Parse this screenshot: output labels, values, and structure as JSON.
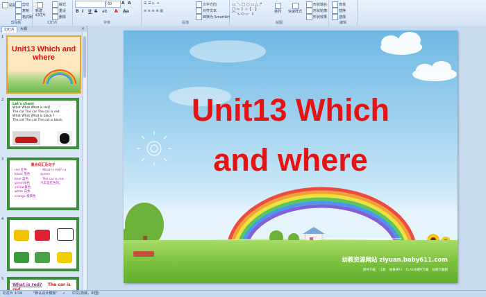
{
  "ribbon": {
    "groups": [
      {
        "label": "剪贴板"
      },
      {
        "label": "幻灯片"
      },
      {
        "label": "字体"
      },
      {
        "label": "段落"
      },
      {
        "label": "绘图"
      },
      {
        "label": "编辑"
      }
    ],
    "clipboard": {
      "paste": "粘贴",
      "cut": "剪切",
      "copy": "复制",
      "format_painter": "格式刷"
    },
    "slides": {
      "new_slide": "新建\n幻灯片",
      "layout": "版式",
      "reset": "重设",
      "delete": "删除"
    },
    "font": {
      "size": "60"
    },
    "paragraph": {
      "text_direction": "文字方向",
      "align_text": "对齐文本",
      "convert_smartart": "转换为 SmartArt"
    },
    "drawing": {
      "arrange": "排列",
      "quick_styles": "快速样式",
      "fill": "形状填充",
      "outline": "形状轮廓",
      "effects": "形状效果"
    },
    "editing": {
      "find": "查找",
      "replace": "替换",
      "select": "选择"
    }
  },
  "left_panel": {
    "tabs": [
      {
        "label": "幻灯片"
      },
      {
        "label": "大纲"
      }
    ],
    "slides": [
      {
        "num": "1",
        "title": "Unit13 Which and where"
      },
      {
        "num": "2",
        "title": "Let's chant",
        "lines": [
          "What What What is red?",
          "The car The car The car is red.",
          "What What What is black ?",
          "The cat The cat The cat is black."
        ]
      },
      {
        "num": "3",
        "title": "重点词汇及句子",
        "left": [
          "· red  红色",
          "· black 黑色",
          "· blue 蓝色",
          "· green绿色",
          "· yellow黄色",
          "· white 白色",
          "· orange 橙黄色"
        ],
        "right": [
          "· What is red?=a queen",
          "· The car is red.",
          "  汽车是红色的。"
        ]
      },
      {
        "num": "4"
      },
      {
        "num": "5",
        "q": "What is red?",
        "a": "The car is red."
      }
    ]
  },
  "slide": {
    "title_line1": "Unit13 Which",
    "title_line2": "and where",
    "site": "幼教资源网站  ziyuan.baby611.com",
    "links": "课件下载 儿歌 故事MP3 FLASH课件下载 幼教下载网"
  },
  "status": {
    "slide_info": "幻灯片 1/34",
    "theme": "\"默认设计模板\"",
    "language": "中文(简体，中国)"
  },
  "colors": {
    "title_red": "#e61313",
    "accent_blue": "#1f3a5f"
  }
}
